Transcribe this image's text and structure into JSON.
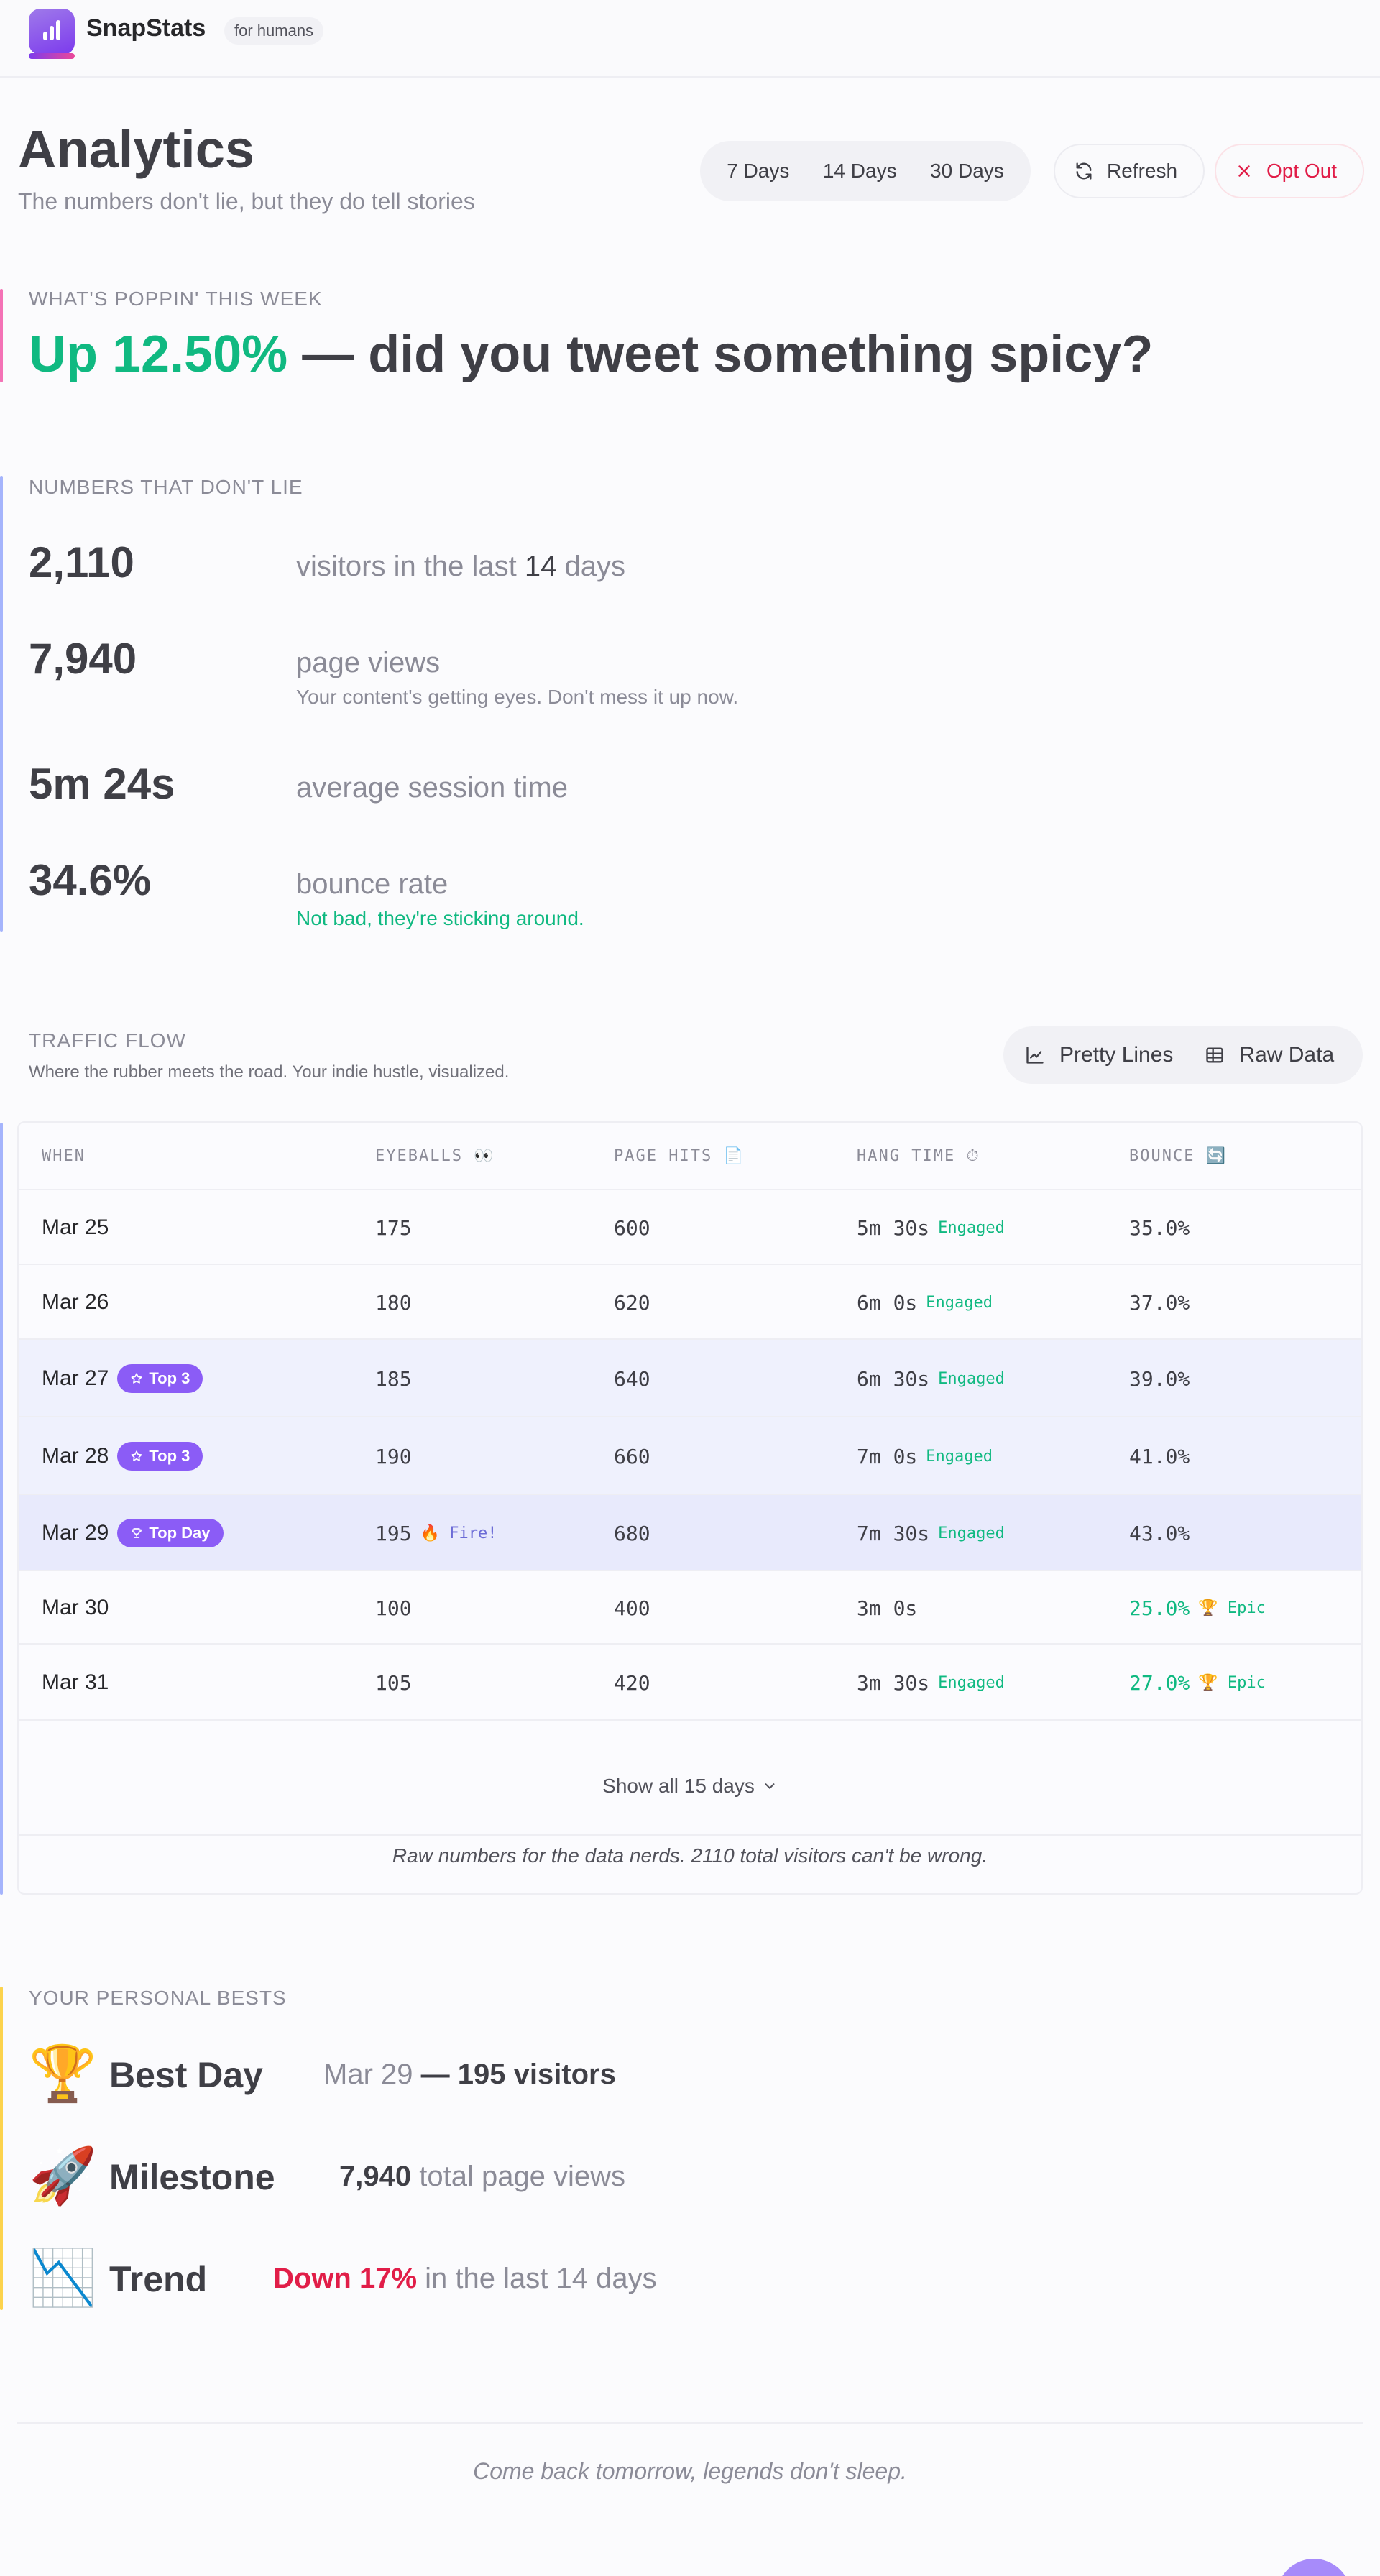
{
  "brand": {
    "name": "SnapStats",
    "tag": "for humans",
    "logo_icon": "bar-chart-icon"
  },
  "header": {
    "title": "Analytics",
    "subtitle": "The numbers don't lie, but they do tell stories",
    "ranges": [
      "7 Days",
      "14 Days",
      "30 Days"
    ],
    "refresh_label": "Refresh",
    "optout_label": "Opt Out"
  },
  "poppin": {
    "label": "WHAT'S POPPIN' THIS WEEK",
    "headline_up": "Up 12.50%",
    "headline_rest": " — did you tweet something spicy?"
  },
  "numbers": {
    "label": "NUMBERS THAT DON'T LIE",
    "visitors": {
      "value": "2,110",
      "label_pre": "visitors in the last ",
      "label_days": "14",
      "label_post": " days"
    },
    "pageviews": {
      "value": "7,940",
      "label": "page views",
      "note": "Your content's getting eyes. Don't mess it up now."
    },
    "session": {
      "value": "5m 24s",
      "label": "average session time"
    },
    "bounce": {
      "value": "34.6%",
      "label": "bounce rate",
      "note": "Not bad, they're sticking around."
    }
  },
  "traffic": {
    "label": "TRAFFIC FLOW",
    "subtitle": "Where the rubber meets the road. Your indie hustle, visualized.",
    "view_options": [
      "Pretty Lines",
      "Raw Data"
    ],
    "columns": [
      "WHEN",
      "EYEBALLS 👀",
      "PAGE HITS 📄",
      "HANG TIME ⏱",
      "BOUNCE 🔄"
    ],
    "rows": [
      {
        "date": "Mar 25",
        "badge": "",
        "visitors": "175",
        "visitors_tag": "",
        "hits": "600",
        "time": "5m 30s",
        "time_tag": "Engaged",
        "bounce": "35.0%",
        "bounce_tag": ""
      },
      {
        "date": "Mar 26",
        "badge": "",
        "visitors": "180",
        "visitors_tag": "",
        "hits": "620",
        "time": "6m 0s",
        "time_tag": "Engaged",
        "bounce": "37.0%",
        "bounce_tag": ""
      },
      {
        "date": "Mar 27",
        "badge": "Top 3",
        "visitors": "185",
        "visitors_tag": "",
        "hits": "640",
        "time": "6m 30s",
        "time_tag": "Engaged",
        "bounce": "39.0%",
        "bounce_tag": ""
      },
      {
        "date": "Mar 28",
        "badge": "Top 3",
        "visitors": "190",
        "visitors_tag": "",
        "hits": "660",
        "time": "7m 0s",
        "time_tag": "Engaged",
        "bounce": "41.0%",
        "bounce_tag": ""
      },
      {
        "date": "Mar 29",
        "badge": "Top Day",
        "visitors": "195",
        "visitors_tag": "🔥 Fire!",
        "hits": "680",
        "time": "7m 30s",
        "time_tag": "Engaged",
        "bounce": "43.0%",
        "bounce_tag": ""
      },
      {
        "date": "Mar 30",
        "badge": "",
        "visitors": "100",
        "visitors_tag": "",
        "hits": "400",
        "time": "3m 0s",
        "time_tag": "",
        "bounce": "25.0%",
        "bounce_tag": "🏆 Epic"
      },
      {
        "date": "Mar 31",
        "badge": "",
        "visitors": "105",
        "visitors_tag": "",
        "hits": "420",
        "time": "3m 30s",
        "time_tag": "Engaged",
        "bounce": "27.0%",
        "bounce_tag": "🏆 Epic"
      }
    ],
    "show_all": "Show all 15 days",
    "raw_note": "Raw numbers for the data nerds. 2110 total visitors can't be wrong."
  },
  "bests": {
    "label": "YOUR PERSONAL BESTS",
    "best_day": {
      "icon": "🏆",
      "title": "Best Day",
      "date": "Mar 29",
      "sep": " — ",
      "value": "195 visitors"
    },
    "milestone": {
      "icon": "🚀",
      "title": "Milestone",
      "value": "7,940",
      "rest": " total page views"
    },
    "trend": {
      "icon": "📉",
      "title": "Trend",
      "value": "Down 17%",
      "rest": " in the last 14 days"
    }
  },
  "footer": {
    "note": "Come back tomorrow, legends don't sleep."
  },
  "colors": {
    "accent": "#8b5cf6",
    "positive": "#10b981",
    "negative": "#e11d48"
  }
}
